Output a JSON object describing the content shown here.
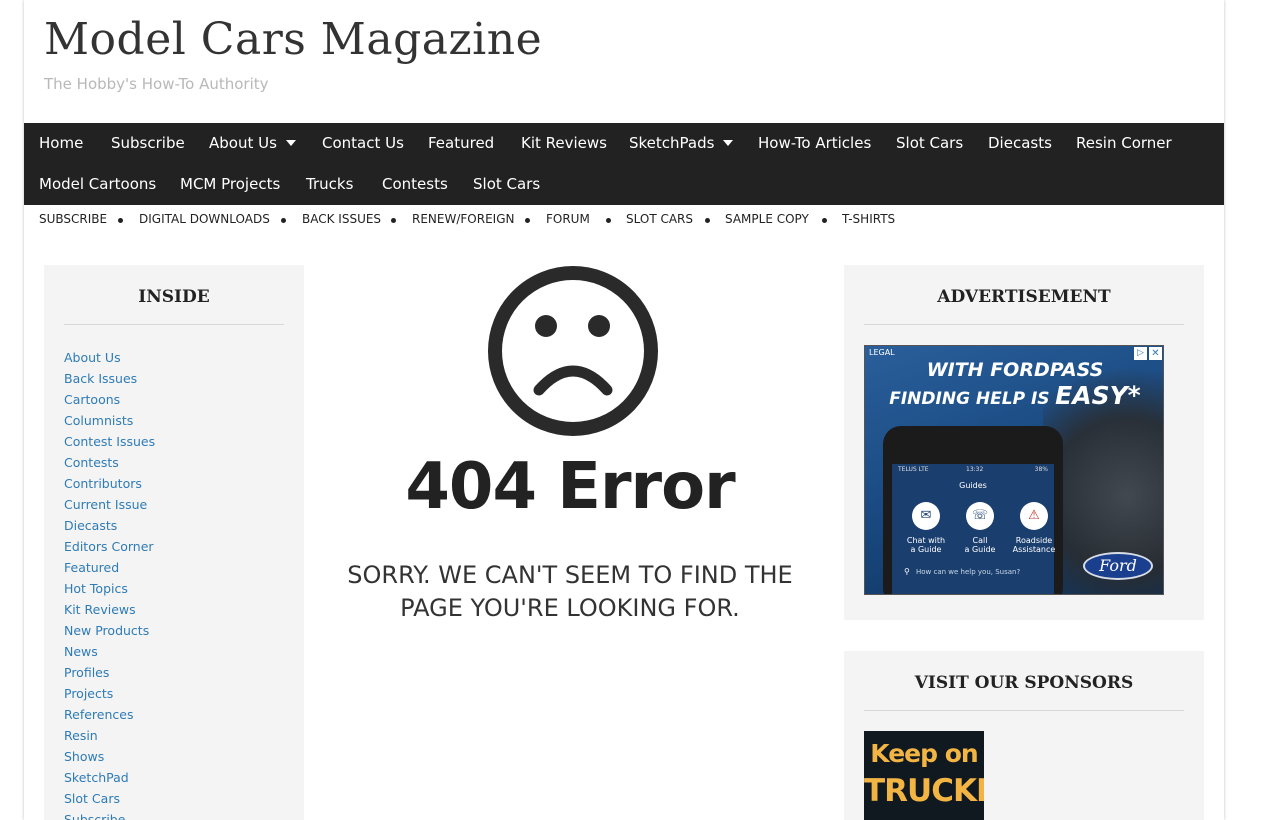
{
  "site": {
    "title": "Model Cars Magazine",
    "tagline": "The Hobby's How-To Authority"
  },
  "main_nav": {
    "row1": [
      {
        "label": "Home",
        "has_dropdown": false
      },
      {
        "label": "Subscribe",
        "has_dropdown": false
      },
      {
        "label": "About Us",
        "has_dropdown": true
      },
      {
        "label": "Contact Us",
        "has_dropdown": false
      },
      {
        "label": "Featured",
        "has_dropdown": false
      },
      {
        "label": "Kit Reviews",
        "has_dropdown": false
      },
      {
        "label": "SketchPads",
        "has_dropdown": true
      },
      {
        "label": "How-To Articles",
        "has_dropdown": false
      },
      {
        "label": "Slot Cars",
        "has_dropdown": false
      },
      {
        "label": "Diecasts",
        "has_dropdown": false
      },
      {
        "label": "Resin Corner",
        "has_dropdown": false
      }
    ],
    "row2": [
      {
        "label": "Model Cartoons",
        "has_dropdown": false
      },
      {
        "label": "MCM Projects",
        "has_dropdown": false
      },
      {
        "label": "Trucks",
        "has_dropdown": false
      },
      {
        "label": "Contests",
        "has_dropdown": false
      },
      {
        "label": "Slot Cars",
        "has_dropdown": false
      }
    ]
  },
  "sub_nav": [
    "SUBSCRIBE",
    "DIGITAL DOWNLOADS",
    "BACK ISSUES",
    "RENEW/FOREIGN",
    "FORUM",
    "SLOT CARS",
    "SAMPLE COPY",
    "T-SHIRTS"
  ],
  "sidebar_left": {
    "title": "INSIDE",
    "items": [
      "About Us",
      "Back Issues",
      "Cartoons",
      "Columnists",
      "Contest Issues",
      "Contests",
      "Contributors",
      "Current Issue",
      "Diecasts",
      "Editors Corner",
      "Featured",
      "Hot Topics",
      "Kit Reviews",
      "New Products",
      "News",
      "Profiles",
      "Projects",
      "References",
      "Resin",
      "Shows",
      "SketchPad",
      "Slot Cars",
      "Subscribe"
    ]
  },
  "error": {
    "icon": "sad-face-icon",
    "heading": "404 Error",
    "message": "SORRY. WE CAN'T SEEM TO FIND THE PAGE YOU'RE LOOKING FOR."
  },
  "sidebar_right": {
    "ad_widget": {
      "title": "ADVERTISEMENT",
      "ad": {
        "legal": "LEGAL",
        "headline_1": "WITH FORDPASS",
        "headline_2": "FINDING HELP IS",
        "headline_emphasis": "EASY*",
        "phone_status": "TELUS LTE",
        "phone_time": "13:32",
        "phone_battery": "38%",
        "phone_screen_title": "Guides",
        "options": [
          {
            "line1": "Chat with",
            "line2": "a Guide"
          },
          {
            "line1": "Call",
            "line2": "a Guide"
          },
          {
            "line1": "Roadside",
            "line2": "Assistance"
          }
        ],
        "search_prompt": "How can we help you, Susan?",
        "brand": "Ford"
      }
    },
    "sponsors_widget": {
      "title": "VISIT OUR SPONSORS",
      "banner_line1": "Keep on",
      "banner_line2": "TRUCKIN'"
    }
  },
  "colors": {
    "nav_bg": "#222222",
    "link": "#2e7bb7",
    "widget_bg": "#f4f4f4",
    "text_dark": "#222222",
    "ad_blue": "#1d4f86",
    "sponsor_yellow": "#f2b544"
  }
}
